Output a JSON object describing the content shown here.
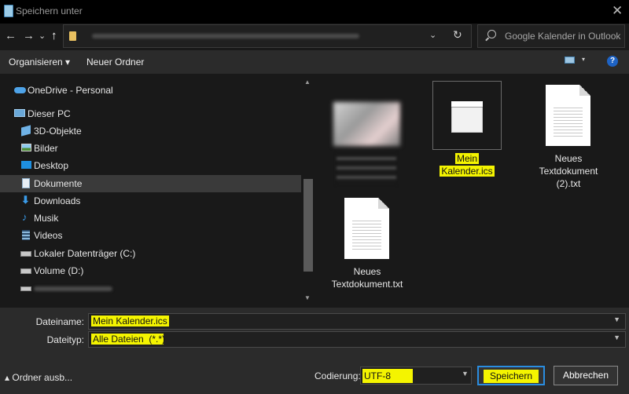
{
  "window": {
    "title": "Speichern unter"
  },
  "nav": {
    "back": "←",
    "forward": "→",
    "recent": "⌄",
    "up": "↑",
    "address_chevron": "⌄",
    "refresh": "↻",
    "search_placeholder": "Google Kalender in Outlook i..."
  },
  "toolbar": {
    "organize": "Organisieren ▾",
    "new_folder": "Neuer Ordner",
    "help": "?"
  },
  "sidebar": {
    "items": [
      {
        "label": "OneDrive - Personal",
        "icon": "cloud-icon"
      },
      {
        "label": "Dieser PC",
        "icon": "computer-icon"
      },
      {
        "label": "3D-Objekte",
        "icon": "cube-icon"
      },
      {
        "label": "Bilder",
        "icon": "pictures-icon"
      },
      {
        "label": "Desktop",
        "icon": "desktop-icon"
      },
      {
        "label": "Dokumente",
        "icon": "documents-icon",
        "selected": true
      },
      {
        "label": "Downloads",
        "icon": "download-icon"
      },
      {
        "label": "Musik",
        "icon": "music-icon"
      },
      {
        "label": "Videos",
        "icon": "video-icon"
      },
      {
        "label": "Lokaler Datenträger (C:)",
        "icon": "drive-icon"
      },
      {
        "label": "Volume (D:)",
        "icon": "drive-icon"
      }
    ]
  },
  "files": {
    "items": [
      {
        "name_line1": "Mein",
        "name_line2": "Kalender.ics",
        "type": "calendar"
      },
      {
        "name_line1": "Neues",
        "name_line2": "Textdokument",
        "name_line3": "(2).txt",
        "type": "text"
      },
      {
        "name_line1": "Neues",
        "name_line2": "Textdokument.txt",
        "type": "text"
      }
    ]
  },
  "form": {
    "filename_label": "Dateiname:",
    "filename_value": "Mein Kalender.ics",
    "filetype_label": "Dateityp:",
    "filetype_value": "Alle Dateien  (*.*)",
    "encoding_label": "Codierung:",
    "encoding_value": "UTF-8"
  },
  "footer": {
    "hide_folders": "▴ Ordner ausb...",
    "save": "Speichern",
    "cancel": "Abbrechen"
  },
  "colors": {
    "highlight": "#f4f400",
    "accent": "#2a8de0"
  }
}
